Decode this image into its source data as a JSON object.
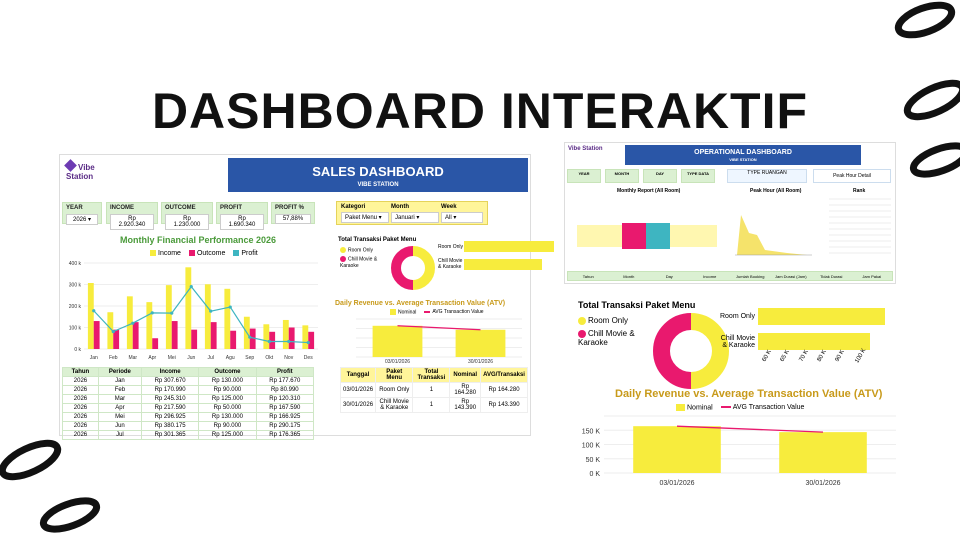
{
  "page": {
    "title": "DASHBOARD INTERAKTIF"
  },
  "sales": {
    "brand": "Vibe Station",
    "header": "SALES DASHBOARD",
    "subheader": "VIBE STATION",
    "cards": [
      {
        "label": "YEAR",
        "value": "2026 ▾"
      },
      {
        "label": "INCOME",
        "value": "Rp 2.920.340"
      },
      {
        "label": "OUTCOME",
        "value": "Rp 1.230.000"
      },
      {
        "label": "PROFIT",
        "value": "Rp 1.690.340"
      },
      {
        "label": "PROFIT %",
        "value": "57,88%"
      }
    ],
    "filters": [
      {
        "label": "Kategori",
        "value": "Paket Menu ▾"
      },
      {
        "label": "Month",
        "value": "Januari ▾"
      },
      {
        "label": "Week",
        "value": "All ▾"
      }
    ],
    "monthly_title": "Monthly Financial Performance 2026",
    "legend": [
      "Income",
      "Outcome",
      "Profit"
    ],
    "donut_title": "Total Transaksi Paket Menu",
    "donut_legend": [
      "Room Only",
      "Chill Movie & Karaoke"
    ],
    "bars_labels": [
      "Room Only",
      "Chill Movie & Karaoke"
    ],
    "atv_title": "Daily Revenue vs. Average Transaction Value (ATV)",
    "atv_legend": [
      "Nominal",
      "AVG Transaction Value"
    ],
    "table": {
      "headers": [
        "Tahun",
        "Periode",
        "Income",
        "Outcome",
        "Profit"
      ],
      "rows": [
        [
          "2026",
          "Jan",
          "Rp 307.670",
          "Rp 130.000",
          "Rp 177.670"
        ],
        [
          "2026",
          "Feb",
          "Rp 170.990",
          "Rp 90.000",
          "Rp 80.990"
        ],
        [
          "2026",
          "Mar",
          "Rp 245.310",
          "Rp 125.000",
          "Rp 120.310"
        ],
        [
          "2026",
          "Apr",
          "Rp 217.590",
          "Rp 50.000",
          "Rp 167.590"
        ],
        [
          "2026",
          "Mei",
          "Rp 296.925",
          "Rp 130.000",
          "Rp 166.925"
        ],
        [
          "2026",
          "Jun",
          "Rp 380.175",
          "Rp 90.000",
          "Rp 290.175"
        ],
        [
          "2026",
          "Jul",
          "Rp 301.365",
          "Rp 125.000",
          "Rp 176.365"
        ]
      ]
    },
    "ytable": {
      "headers": [
        "Tanggal",
        "Paket Menu",
        "Total Transaksi",
        "Nominal",
        "AVG/Transaksi"
      ],
      "rows": [
        [
          "03/01/2026",
          "Room Only",
          "1",
          "Rp 164.280",
          "Rp 164.280"
        ],
        [
          "30/01/2026",
          "Chill Movie & Karaoke",
          "1",
          "Rp 143.390",
          "Rp 143.390"
        ]
      ]
    }
  },
  "ops": {
    "brand": "Vibe Station",
    "header": "OPERATIONAL DASHBOARD",
    "subheader": "VIBE STATION",
    "monthly_report": "Monthly Report (All Room)",
    "peak_hour": "Peak Hour (All Room)",
    "peak_hour_detail": "Peak Hour Detail",
    "rank": "Rank",
    "type_ruangan": "TYPE RUANGAN",
    "cards": [
      "YEAR",
      "MONTH",
      "DAY",
      "TYPE DATA"
    ],
    "table_headers": [
      "Tahun",
      "Month",
      "Day",
      "Income",
      "Jumlah Booking",
      "Jam Durasi (Jam)",
      "Tidak Durasi",
      "Jam Pakai"
    ]
  },
  "zoom": {
    "donut_title": "Total Transaksi Paket Menu",
    "donut_legend": [
      "Room Only",
      "Chill Movie & Karaoke"
    ],
    "bars_labels": [
      "Room Only",
      "Chill Movie & Karaoke"
    ],
    "bars_ticks": [
      "60 K",
      "65 K",
      "70 K",
      "80 K",
      "90 K",
      "100 K"
    ],
    "atv_title": "Daily Revenue vs. Average Transaction Value (ATV)",
    "atv_legend": [
      "Nominal",
      "AVG Transaction Value"
    ],
    "atv_yticks": [
      "150 K",
      "100 K",
      "50 K",
      "0 K"
    ],
    "atv_xticks": [
      "03/01/2026",
      "30/01/2026"
    ]
  },
  "chart_data": [
    {
      "type": "bar",
      "title": "Monthly Financial Performance 2026",
      "categories": [
        "Jan",
        "Feb",
        "Mar",
        "Apr",
        "Mei",
        "Jun",
        "Jul",
        "Agu",
        "Sep",
        "Okt",
        "Nov",
        "Des"
      ],
      "series": [
        {
          "name": "Income",
          "values": [
            307,
            171,
            245,
            218,
            297,
            380,
            301,
            280,
            150,
            115,
            135,
            110
          ]
        },
        {
          "name": "Outcome",
          "values": [
            130,
            90,
            125,
            50,
            130,
            90,
            125,
            85,
            95,
            80,
            100,
            80
          ]
        },
        {
          "name": "Profit",
          "values": [
            178,
            81,
            120,
            168,
            167,
            290,
            176,
            195,
            55,
            35,
            35,
            30
          ]
        }
      ],
      "yticks": [
        "400 k",
        "300 k",
        "200 k",
        "100 k",
        "0 k"
      ],
      "ylim": [
        0,
        400
      ]
    },
    {
      "type": "pie",
      "title": "Total Transaksi Paket Menu",
      "categories": [
        "Room Only",
        "Chill Movie & Karaoke"
      ],
      "values": [
        1,
        1
      ]
    },
    {
      "type": "bar",
      "title": "Daily Revenue vs. Average Transaction Value (ATV)",
      "categories": [
        "03/01/2026",
        "30/01/2026"
      ],
      "series": [
        {
          "name": "Nominal",
          "values": [
            164280,
            143390
          ]
        },
        {
          "name": "AVG Transaction Value",
          "values": [
            164280,
            143390
          ]
        }
      ],
      "ylim": [
        0,
        200000
      ]
    }
  ],
  "colors": {
    "blue": "#2a56a7",
    "yellow": "#f7ec3d",
    "pink": "#e9196e",
    "teal": "#3eb5c1",
    "green": "#6fb24e"
  }
}
